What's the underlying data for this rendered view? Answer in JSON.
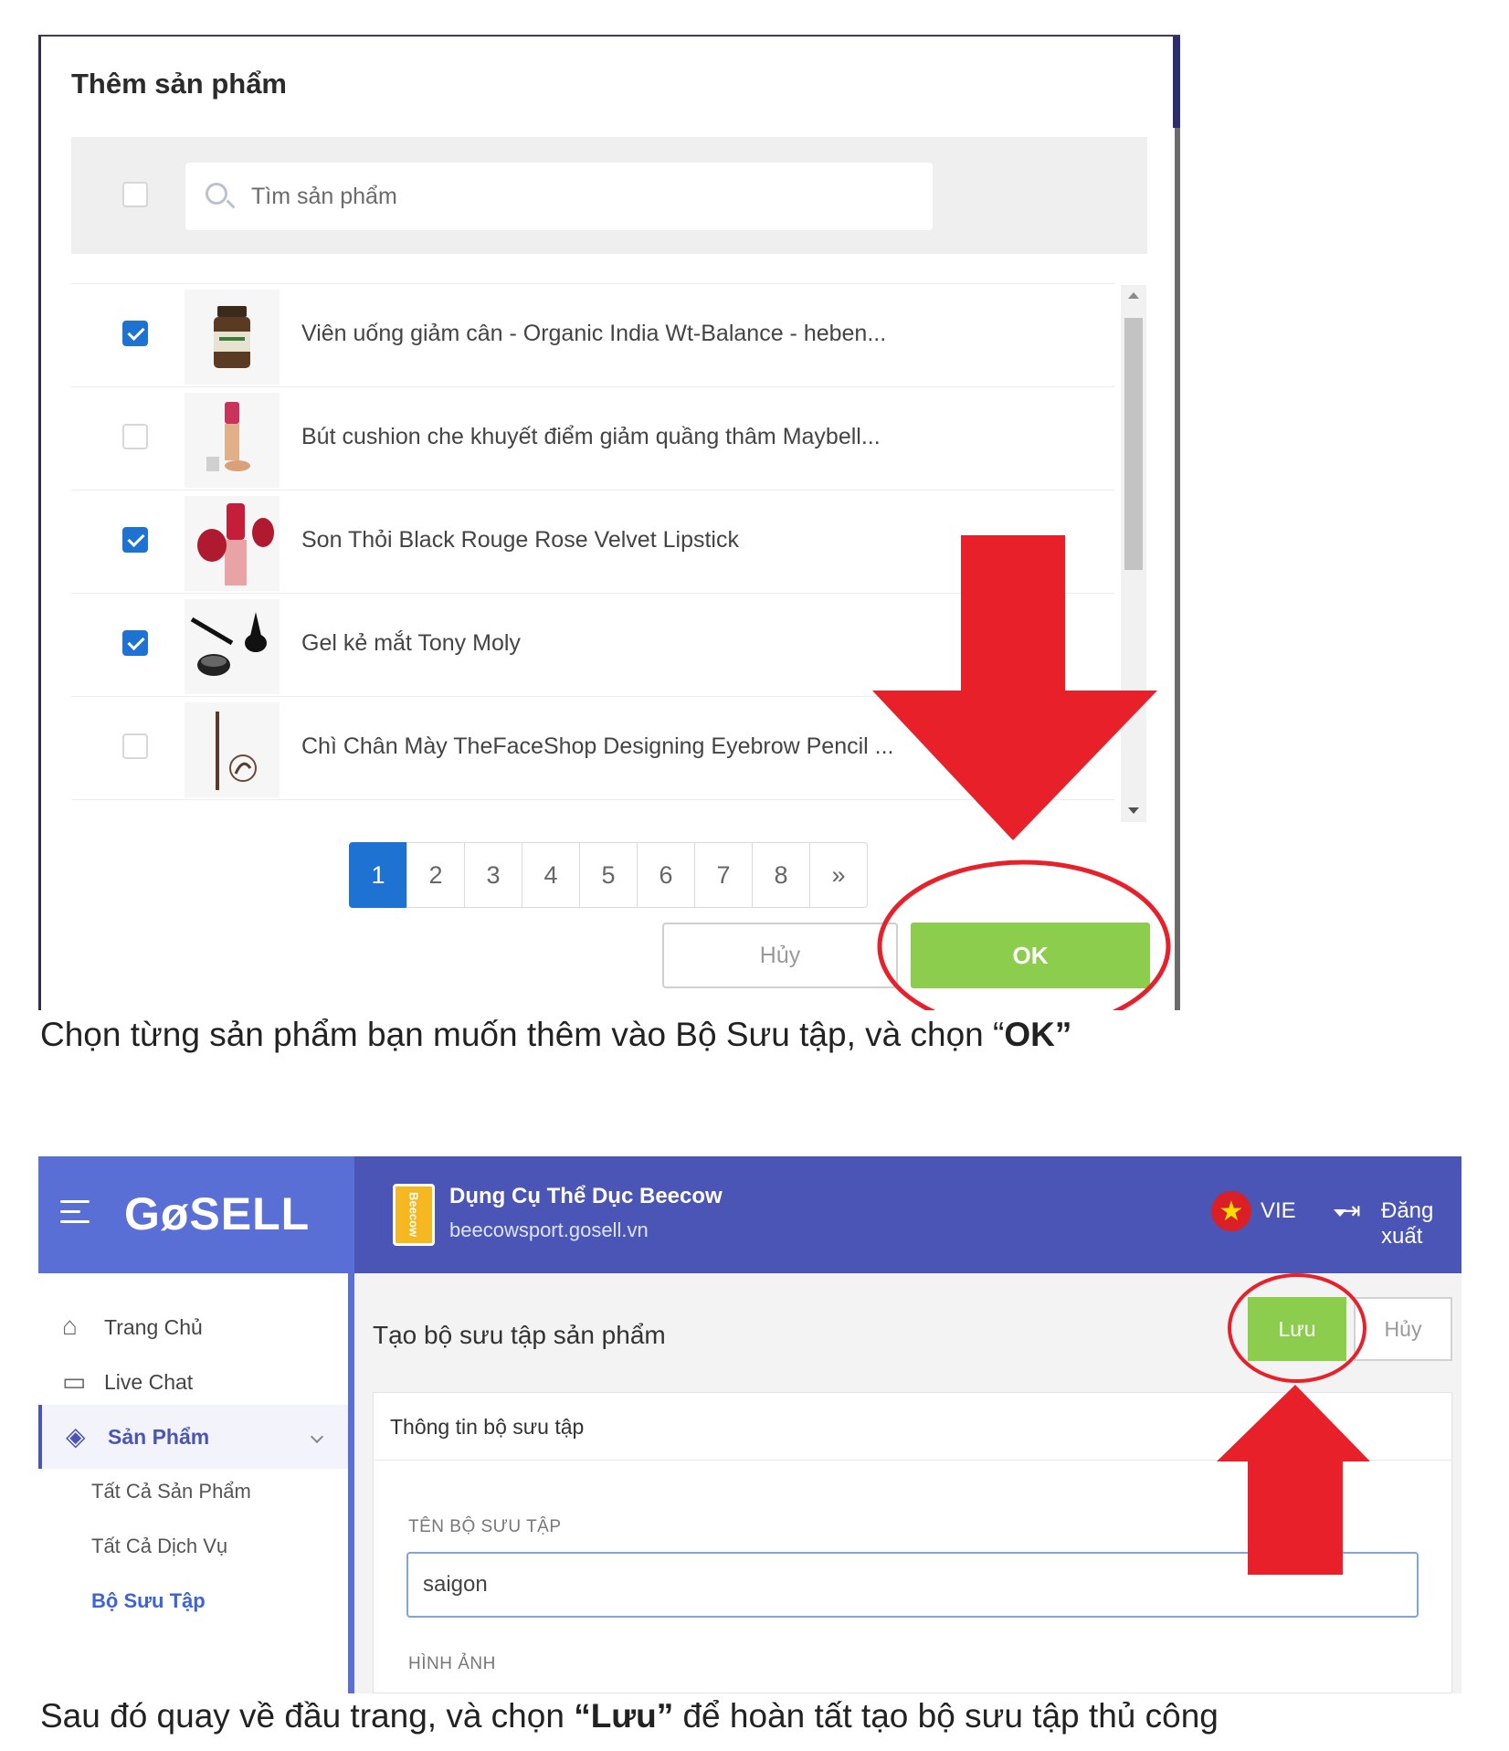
{
  "modal": {
    "title": "Thêm sản phẩm",
    "search_placeholder": "Tìm sản phẩm",
    "select_all_checked": false,
    "products": [
      {
        "label": "Viên uống giảm cân - Organic India Wt-Balance - heben...",
        "checked": true,
        "thumb": "supplement-jar"
      },
      {
        "label": "Bút cushion che khuyết điểm giảm quầng thâm Maybell...",
        "checked": false,
        "thumb": "cushion-pen"
      },
      {
        "label": "Son Thỏi Black Rouge Rose Velvet Lipstick",
        "checked": true,
        "thumb": "lipstick"
      },
      {
        "label": "Gel kẻ mắt Tony Moly",
        "checked": true,
        "thumb": "eyeliner-gel"
      },
      {
        "label": "Chì Chân Mày TheFaceShop Designing Eyebrow Pencil ...",
        "checked": false,
        "thumb": "eyebrow-pencil"
      }
    ],
    "pages": [
      "1",
      "2",
      "3",
      "4",
      "5",
      "6",
      "7",
      "8",
      "»"
    ],
    "active_page": "1",
    "cancel_label": "Hủy",
    "ok_label": "OK"
  },
  "caption1": {
    "before": "Chọn từng sản phẩm bạn muốn thêm vào Bộ Sưu tập, và chọn ",
    "quote_open": "“",
    "bold": "OK",
    "quote_close": "”"
  },
  "admin": {
    "logo": "GøSELL",
    "store_logo_text": "Beecow",
    "store_name": "Dụng Cụ Thể Dục Beecow",
    "store_url": "beecowsport.gosell.vn",
    "language": "VIE",
    "logout_label": "Đăng xuất",
    "sidebar": {
      "items": [
        {
          "label": "Trang Chủ",
          "icon": "home-icon"
        },
        {
          "label": "Live Chat",
          "icon": "chat-icon"
        },
        {
          "label": "Sản Phẩm",
          "icon": "tag-icon"
        }
      ],
      "sub_items": [
        "Tất Cả Sản Phẩm",
        "Tất Cả Dịch Vụ",
        "Bộ Sưu Tập"
      ]
    },
    "page_title": "Tạo bộ sưu tập sản phẩm",
    "save_label": "Lưu",
    "cancel_label": "Hủy",
    "panel_title": "Thông tin bộ sưu tập",
    "name_label": "TÊN BỘ SƯU TẬP",
    "name_value": "saigon",
    "image_label": "HÌNH ẢNH"
  },
  "caption2": {
    "before": "Sau đó quay về đầu trang, và chọn ",
    "bold": "“Lưu”",
    "after": " để hoàn tất tạo bộ sưu tập thủ công"
  },
  "colors": {
    "primary_blue": "#1e73d2",
    "ok_green": "#8dcd4e",
    "annotation_red": "#e8202a",
    "gosell_header": "#4a55b5"
  }
}
